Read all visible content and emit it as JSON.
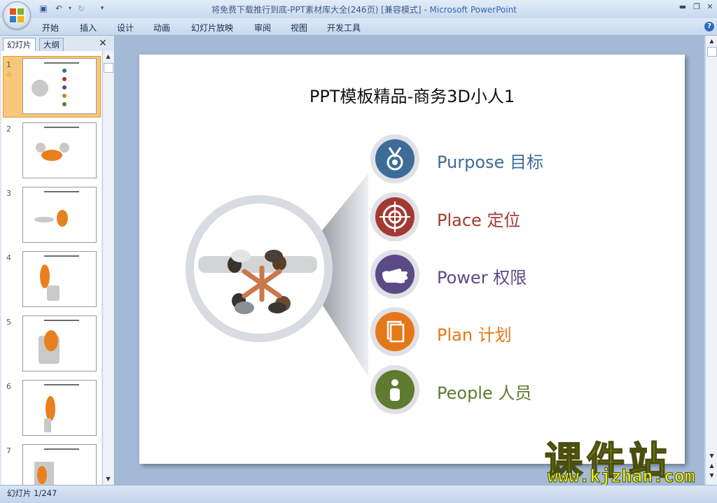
{
  "window": {
    "title": "将免费下载推行到底-PPT素材库大全(246页) [兼容模式] - ",
    "app_name": "Microsoft PowerPoint"
  },
  "ribbon": {
    "tabs": [
      "开始",
      "插入",
      "设计",
      "动画",
      "幻灯片放映",
      "审阅",
      "视图",
      "开发工具"
    ]
  },
  "left_pane": {
    "tabs": [
      "幻灯片",
      "大纲"
    ],
    "slide_numbers": [
      "1",
      "2",
      "3",
      "4",
      "5",
      "6",
      "7"
    ]
  },
  "slide": {
    "title": "PPT模板精品-商务3D小人1",
    "items": [
      {
        "label": "Purpose 目标",
        "color": "#3d6c99",
        "icon": "medal-icon"
      },
      {
        "label": "Place 定位",
        "color": "#a23a33",
        "icon": "target-icon"
      },
      {
        "label": "Power 权限",
        "color": "#5c4a86",
        "icon": "hand-icon"
      },
      {
        "label": "Plan 计划",
        "color": "#e57718",
        "icon": "documents-icon"
      },
      {
        "label": "People 人员",
        "color": "#5f7b2f",
        "icon": "person-icon"
      }
    ]
  },
  "status": {
    "slide_counter": "幻灯片 1/247"
  },
  "watermark": {
    "main": "课件站",
    "url": "www.kjzhan.com"
  }
}
